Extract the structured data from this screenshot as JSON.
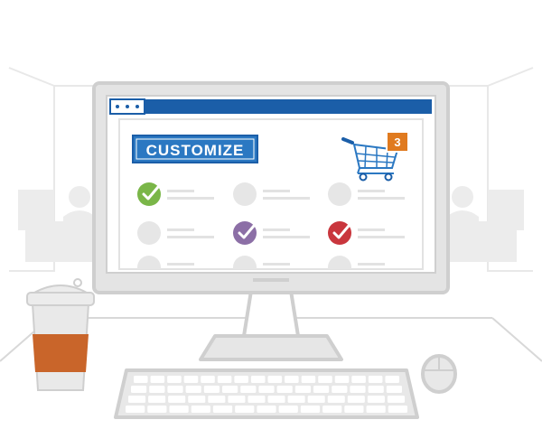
{
  "screen": {
    "banner_label": "CUSTOMIZE",
    "cart_count": "3",
    "options": [
      {
        "row": 1,
        "col": 1,
        "state": "checked",
        "color": "#7ab648"
      },
      {
        "row": 1,
        "col": 2,
        "state": "unchecked",
        "color": "#e6e6e6"
      },
      {
        "row": 1,
        "col": 3,
        "state": "unchecked",
        "color": "#e6e6e6"
      },
      {
        "row": 2,
        "col": 1,
        "state": "unchecked",
        "color": "#e6e6e6"
      },
      {
        "row": 2,
        "col": 2,
        "state": "checked",
        "color": "#8c6fa6"
      },
      {
        "row": 2,
        "col": 3,
        "state": "checked",
        "color": "#c9363d"
      },
      {
        "row": 3,
        "col": 1,
        "state": "unchecked",
        "color": "#e6e6e6"
      },
      {
        "row": 3,
        "col": 2,
        "state": "unchecked",
        "color": "#e6e6e6"
      },
      {
        "row": 3,
        "col": 3,
        "state": "unchecked",
        "color": "#e6e6e6"
      }
    ]
  },
  "colors": {
    "brand_blue": "#1b5ea8",
    "banner_blue": "#2b78c2",
    "badge_orange": "#e07a1f",
    "cup_sleeve": "#c9652a",
    "outline_gray": "#cfcfcf",
    "fill_gray": "#e6e6e6"
  }
}
